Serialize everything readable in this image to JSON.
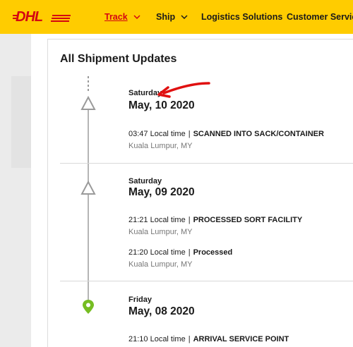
{
  "header": {
    "logo_text": "DHL",
    "nav": [
      {
        "label": "Track",
        "active": true,
        "has_dropdown": true
      },
      {
        "label": "Ship",
        "active": false,
        "has_dropdown": true
      },
      {
        "label": "Logistics Solutions",
        "active": false,
        "has_dropdown": false
      },
      {
        "label": "Customer Service",
        "active": false,
        "has_dropdown": false
      }
    ],
    "background_color": "#ffcc00",
    "logo_color": "#d40511"
  },
  "main": {
    "title": "All Shipment Updates",
    "groups": [
      {
        "day": "Saturday",
        "date": "May, 10 2020",
        "marker": "triangle-outline-icon",
        "events": [
          {
            "time": "03:47 Local time",
            "status": "SCANNED INTO SACK/CONTAINER",
            "location": "Kuala Lumpur, MY"
          }
        ]
      },
      {
        "day": "Saturday",
        "date": "May, 09 2020",
        "marker": "triangle-outline-icon",
        "events": [
          {
            "time": "21:21 Local time",
            "status": "PROCESSED SORT FACILITY",
            "location": "Kuala Lumpur, MY"
          },
          {
            "time": "21:20 Local time",
            "status": "Processed",
            "location": "Kuala Lumpur, MY"
          }
        ]
      },
      {
        "day": "Friday",
        "date": "May, 08 2020",
        "marker": "map-pin-icon",
        "events": [
          {
            "time": "21:10 Local time",
            "status": "ARRIVAL SERVICE POINT",
            "location": ""
          }
        ]
      }
    ],
    "separator": "|",
    "pin_color": "#76bd22",
    "annotation": "red-arrow-annotation"
  }
}
